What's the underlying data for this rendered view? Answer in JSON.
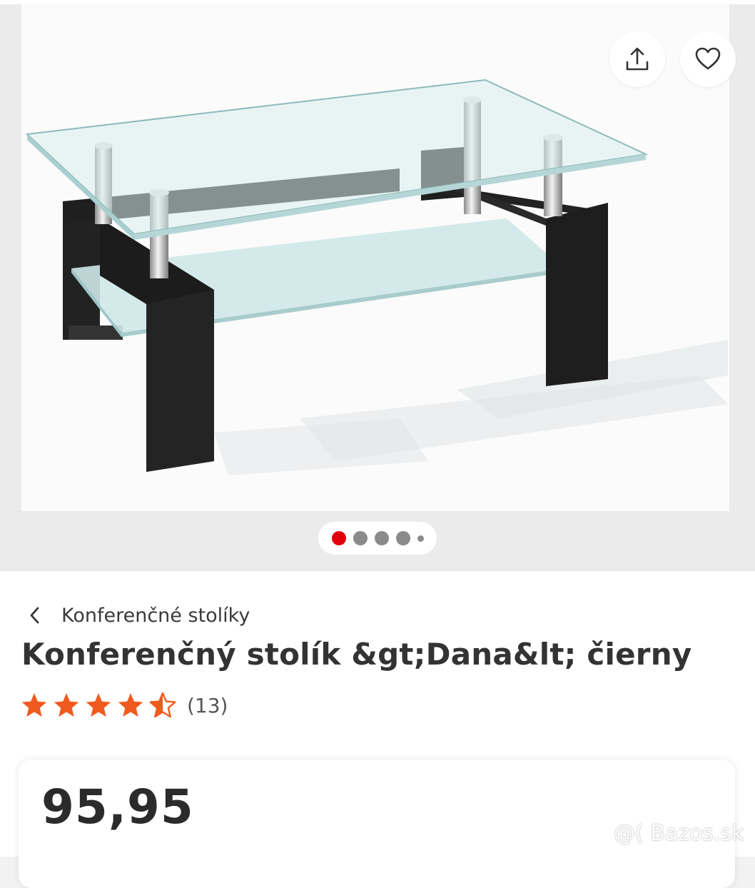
{
  "gallery": {
    "active_index": 0,
    "dots": [
      {
        "state": "active"
      },
      {
        "state": "inactive"
      },
      {
        "state": "inactive"
      },
      {
        "state": "inactive"
      },
      {
        "state": "small"
      }
    ],
    "share_icon": "share-icon",
    "favorite_icon": "heart-icon"
  },
  "breadcrumb": {
    "back_icon": "chevron-left-icon",
    "label": "Konferenčné stolíky"
  },
  "product": {
    "title": "Konferenčný stolík &gt;Dana&lt; čierny",
    "rating_value": 4.5,
    "rating_max": 5,
    "rating_count": "(13)"
  },
  "price": {
    "amount": "95,95"
  },
  "watermark": "@( Bazos.sk",
  "colors": {
    "accent_red": "#e0000a",
    "star_orange": "#f05a1e",
    "text_dark": "#333333"
  }
}
